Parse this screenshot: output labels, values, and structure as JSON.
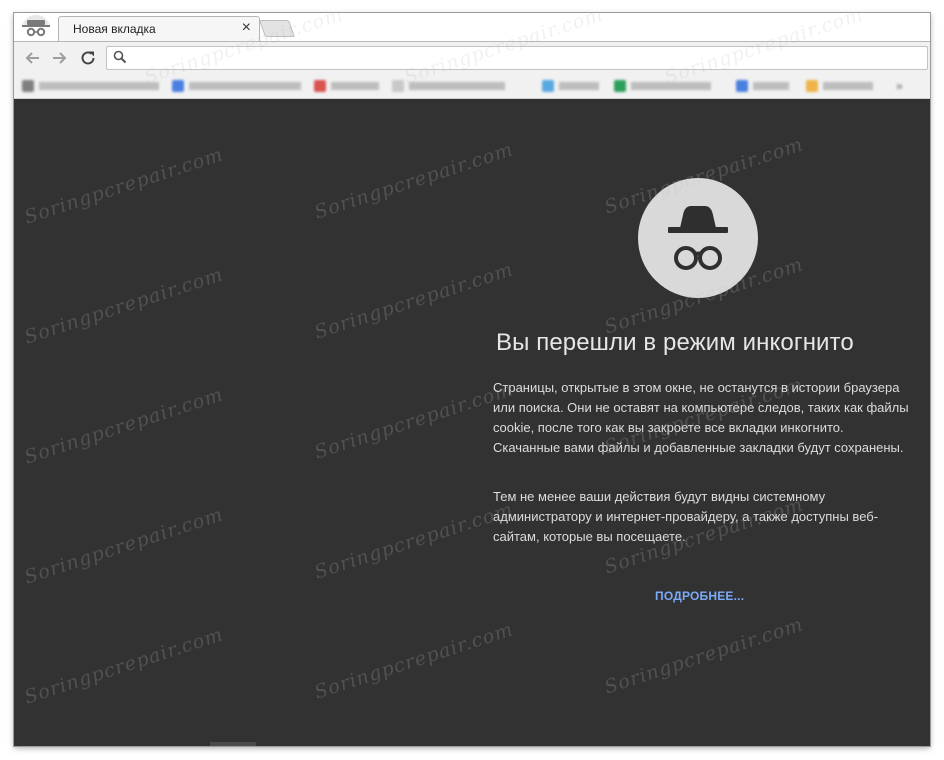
{
  "tab": {
    "title": "Новая вкладка",
    "close_symbol": "×"
  },
  "toolbar": {
    "back_icon": "back-arrow-icon",
    "forward_icon": "forward-arrow-icon",
    "reload_icon": "reload-icon",
    "omnibox_value": "",
    "search_icon": "search-icon"
  },
  "incognito": {
    "icon": "incognito-icon",
    "heading": "Вы перешли в режим инкогнито",
    "paragraph1": "Страницы, открытые в этом окне, не останутся в истории браузера или поиска. Они не оставят на компьютере следов, таких как файлы cookie, после того как вы закроете все вкладки инкогнито. Скачанные вами файлы и добавленные закладки будут сохранены.",
    "paragraph2": "Тем не менее ваши действия будут видны системному администратору и интернет-провайдеру, а также доступны веб-сайтам, которые вы посещаете.",
    "learn_more": "ПОДРОБНЕЕ...",
    "link_color": "#7baaf7",
    "background": "#323232"
  },
  "watermark": {
    "text": "Soringpcrepair.com"
  }
}
